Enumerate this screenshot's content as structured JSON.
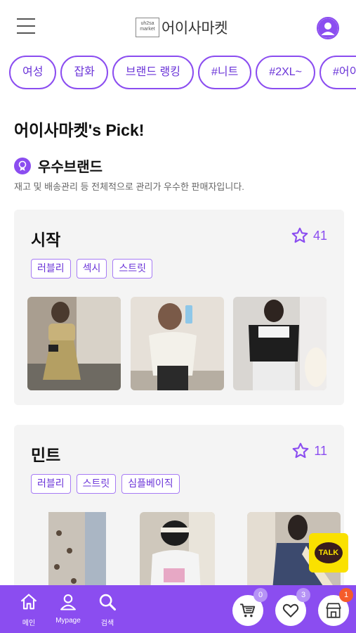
{
  "header": {
    "logo_box_line1": "uh2sa",
    "logo_box_line2": "market",
    "logo_text": "어이사마켓"
  },
  "chips": [
    "여성",
    "잡화",
    "브랜드 랭킹",
    "#니트",
    "#2XL~",
    "#어이"
  ],
  "pick_title": "어이사마켓's Pick!",
  "section": {
    "title": "우수브랜드",
    "description": "재고 및 배송관리 등 전체적으로 관리가 우수한 판매자입니다."
  },
  "stores": [
    {
      "name": "시작",
      "favorites": "41",
      "tags": [
        "러블리",
        "섹시",
        "스트릿"
      ]
    },
    {
      "name": "민트",
      "favorites": "11",
      "tags": [
        "러블리",
        "스트릿",
        "심플베이직"
      ]
    }
  ],
  "kakao": {
    "label": "TALK"
  },
  "bottom_nav": {
    "items": [
      "메인",
      "Mypage",
      "검색"
    ],
    "cart_count": "0",
    "wishlist_count": "3",
    "store_count": "1"
  },
  "colors": {
    "accent": "#8b4df0",
    "talk_yellow": "#fae100",
    "alert": "#f55c2b"
  }
}
